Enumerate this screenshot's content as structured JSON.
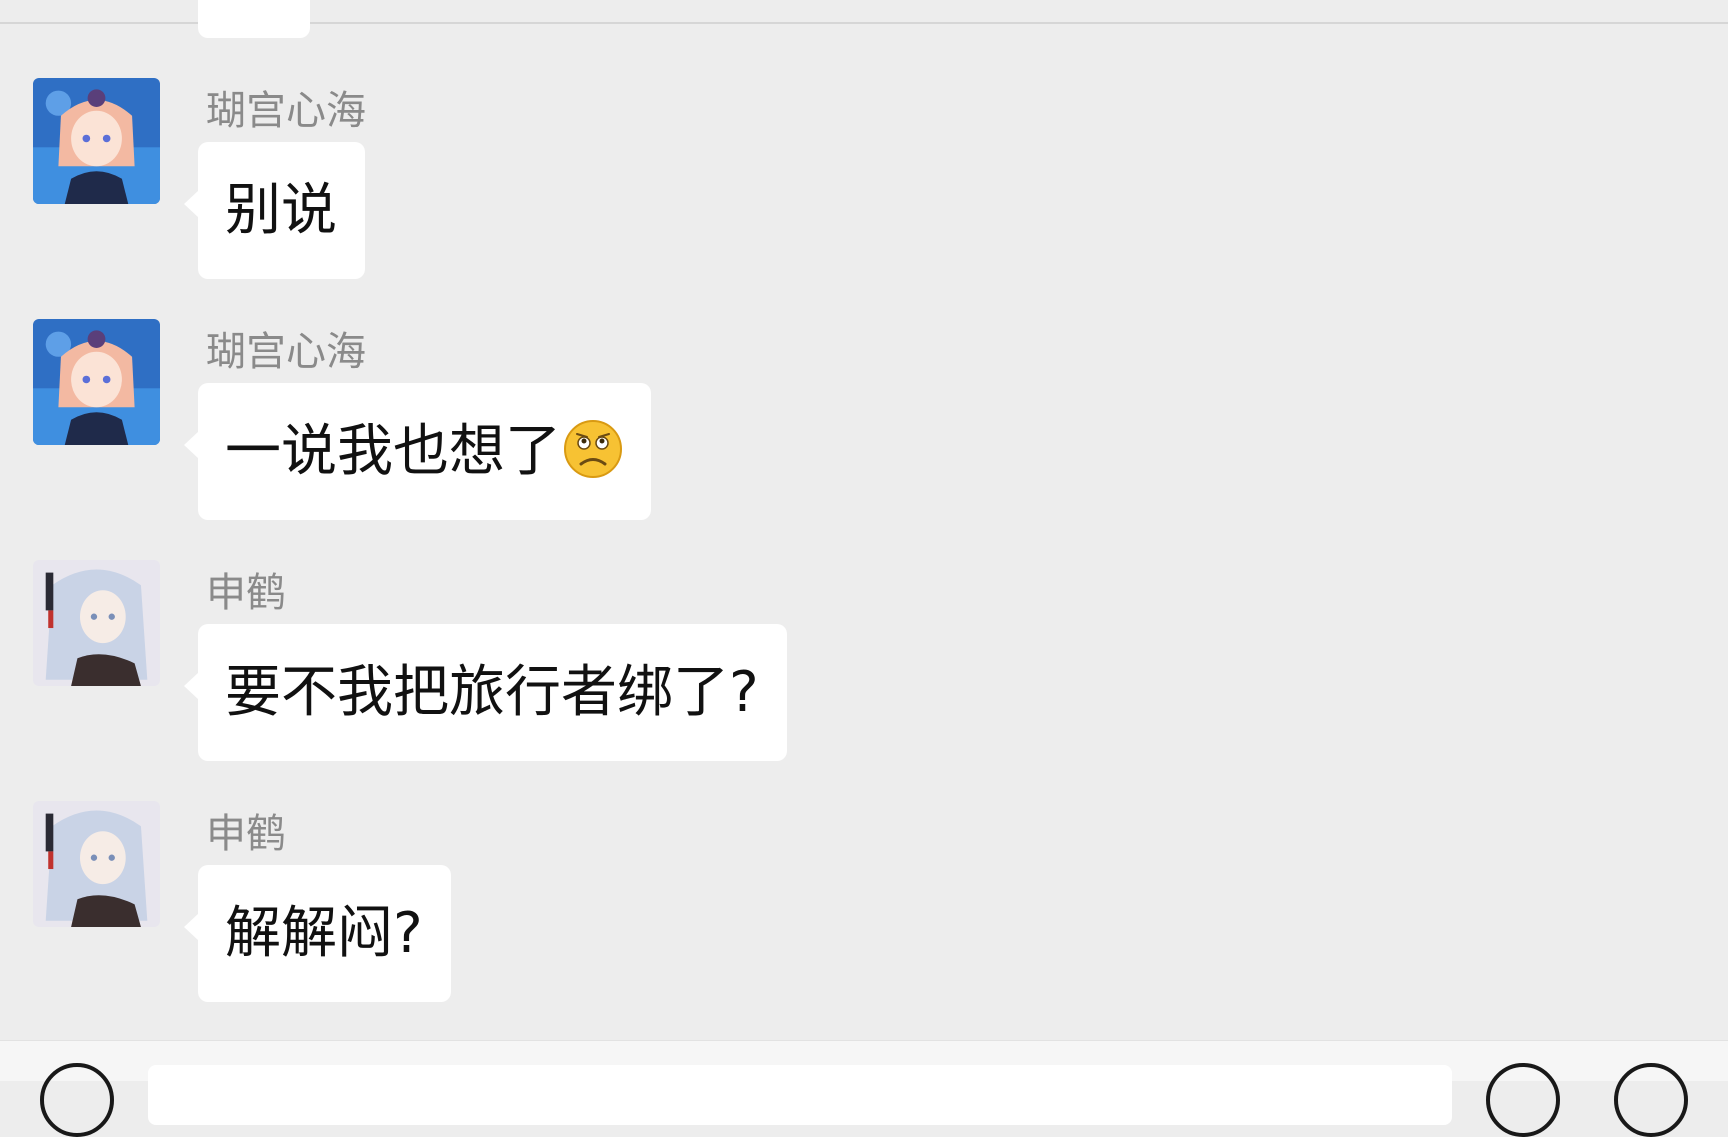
{
  "colors": {
    "background": "#ededed",
    "bubble": "#ffffff",
    "sender_name": "#8a8a8a",
    "message_text": "#111111"
  },
  "messages": [
    {
      "sender": "瑚宫心海",
      "text": "别说",
      "avatar": "kokomi-avatar"
    },
    {
      "sender": "瑚宫心海",
      "text": "一说我也想了",
      "emoji": "frowning-emoji",
      "avatar": "kokomi-avatar"
    },
    {
      "sender": "申鹤",
      "text": "要不我把旅行者绑了?",
      "avatar": "shenhe-avatar"
    },
    {
      "sender": "申鹤",
      "text": "解解闷?",
      "avatar": "shenhe-avatar"
    }
  ],
  "input_bar": {
    "voice_icon": "voice-icon",
    "emoji_icon": "emoji-icon",
    "plus_icon": "plus-icon"
  }
}
